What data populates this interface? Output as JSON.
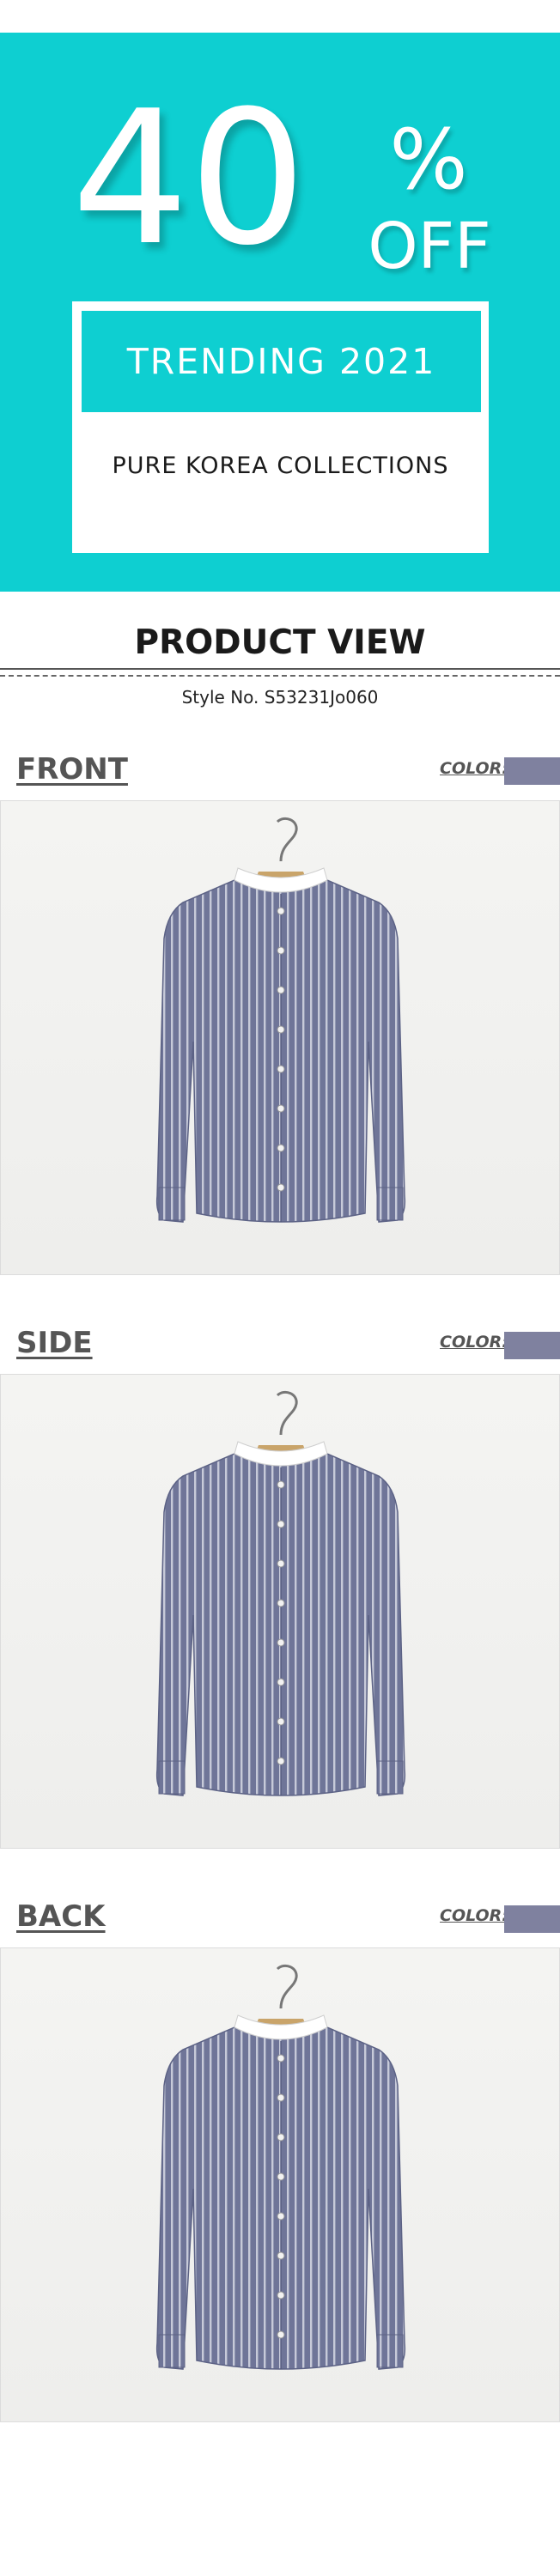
{
  "banner": {
    "discount_number": "40",
    "percent_sign": "%",
    "off_text": "OFF",
    "headline": "TRENDING 2021",
    "subline": "PURE KOREA COLLECTIONS",
    "bg_color": "#0ecfd1"
  },
  "product_view": {
    "title": "PRODUCT VIEW",
    "style_no": "Style No. S53231Jo060"
  },
  "sections": [
    {
      "label": "FRONT",
      "color_label": "COLOR:",
      "swatch_color": "#7f819f"
    },
    {
      "label": "SIDE",
      "color_label": "COLOR:",
      "swatch_color": "#7f819f"
    },
    {
      "label": "BACK",
      "color_label": "COLOR:",
      "swatch_color": "#7f819f"
    }
  ],
  "shirt": {
    "body_color": "#6f7598",
    "stripe_color": "#e4e6ee",
    "collar_color": "#ffffff",
    "hanger_color": "#c9a46a"
  }
}
